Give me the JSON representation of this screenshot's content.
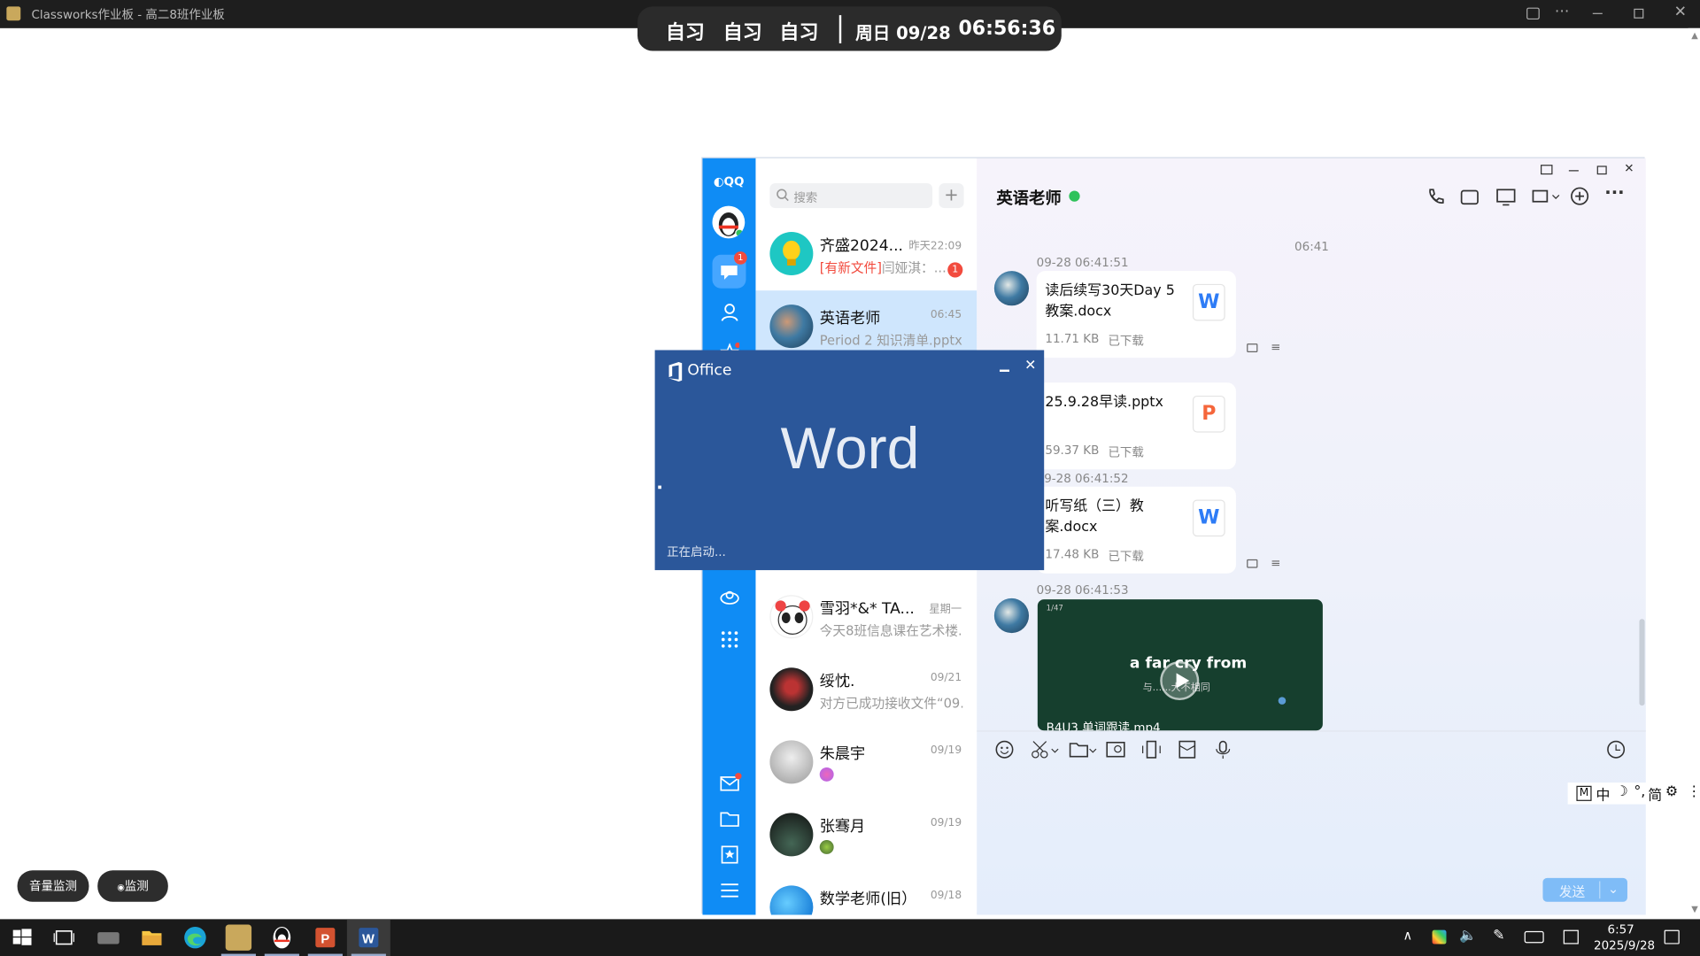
{
  "topbar": {
    "title": "Classworks作业板 - 高二8班作业板"
  },
  "pill": {
    "s1": "自习",
    "s2": "自习",
    "s3": "自习",
    "date": "周日 09/28",
    "time": "06:56:36"
  },
  "qq": {
    "logo": "QQ",
    "search_placeholder": "搜索",
    "unread": "1",
    "chats": [
      {
        "name": "齐盛2024...",
        "time": "昨天22:09",
        "preview_tag": "[有新文件]",
        "preview": "闫娅淇：...",
        "badge": "1"
      },
      {
        "name": "英语老师",
        "time": "06:45",
        "preview": "Period 2 知识清单.pptx"
      },
      {
        "name": "雪羽*&* TA...",
        "time": "星期一",
        "preview": "今天8班信息课在艺术楼..."
      },
      {
        "name": "绥忱.",
        "time": "09/21",
        "preview": "对方已成功接收文件“09..."
      },
      {
        "name": "朱晨宇",
        "time": "09/19",
        "preview": ""
      },
      {
        "name": "张骞月",
        "time": "09/19",
        "preview": ""
      },
      {
        "name": "数学老师(旧）",
        "time": "09/18",
        "preview": ""
      }
    ],
    "chat": {
      "title": "英语老师",
      "time_center": "06:41",
      "messages": [
        {
          "ts": "09-28 06:41:51",
          "file": "读后续写30天Day 5 教案.docx",
          "size": "11.71 KB",
          "status": "已下载",
          "icon": "W"
        },
        {
          "file": "25.9.28早读.pptx",
          "size": "59.37 KB",
          "status": "已下载",
          "icon": "P"
        },
        {
          "ts": "09-28 06:41:52",
          "file": "听写纸（三）教案.docx",
          "size": "17.48 KB",
          "status": "已下载",
          "icon": "W"
        },
        {
          "ts": "09-28 06:41:53",
          "video_title": "a far cry from",
          "video_sub": "与......大不相同",
          "video_file": "B4U3 单词跟读.mp4",
          "video_counter": "1/47"
        }
      ],
      "send": "发送"
    }
  },
  "ime": {
    "mode": "中",
    "simp": "简"
  },
  "office": {
    "brand": "Office",
    "app": "Word",
    "status": "正在启动..."
  },
  "float": {
    "b1": "音量监测",
    "b2": "监测"
  },
  "taskbar": {
    "time": "6:57",
    "date": "2025/9/28"
  },
  "colors": {
    "qq_blue": "#0f8cf5",
    "word_blue": "#2b579a",
    "badge_red": "#f24b3e",
    "online_green": "#2fc25b"
  }
}
